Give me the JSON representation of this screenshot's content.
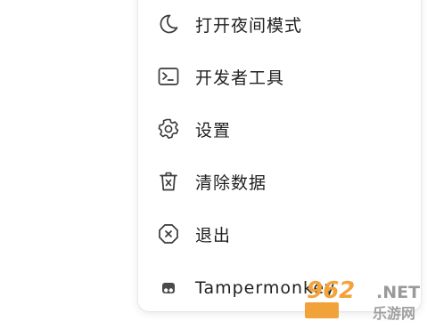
{
  "menu": {
    "items": [
      {
        "icon": "moon-icon",
        "label": "打开夜间模式"
      },
      {
        "icon": "terminal-icon",
        "label": "开发者工具"
      },
      {
        "icon": "gear-icon",
        "label": "设置"
      },
      {
        "icon": "trash-icon",
        "label": "清除数据"
      },
      {
        "icon": "close-circle-icon",
        "label": "退出"
      },
      {
        "icon": "tampermonkey-icon",
        "label": "Tampermonkey"
      }
    ]
  },
  "watermark": {
    "top": "962",
    "net": ".NET",
    "bottom": "乐游网"
  },
  "colors": {
    "icon": "#3a3a3a",
    "text": "#1f1f1f",
    "watermark_orange": "#f3a33a"
  }
}
